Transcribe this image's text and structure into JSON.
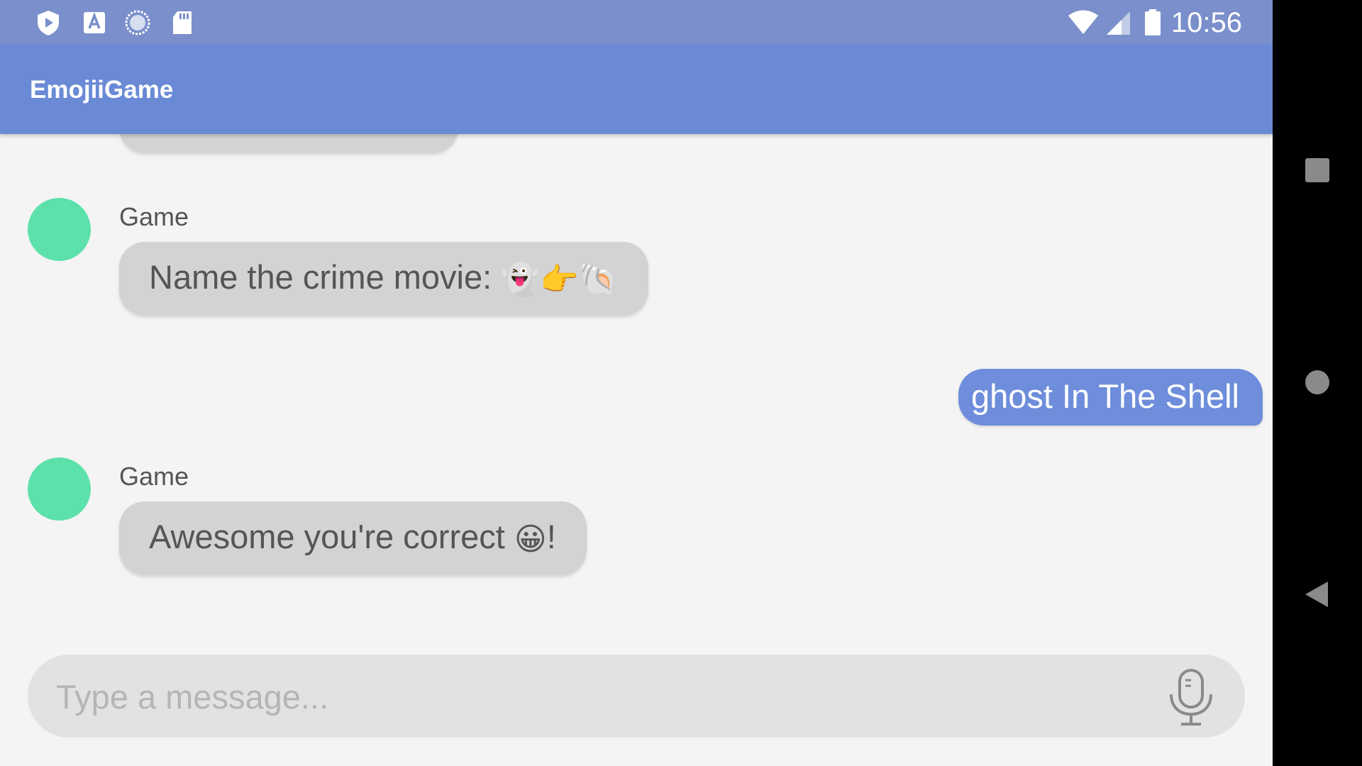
{
  "status_bar": {
    "time": "10:56",
    "icons": [
      "shield-play-icon",
      "a-notification-icon",
      "sync-icon",
      "sd-card-icon",
      "wifi-icon",
      "signal-icon",
      "battery-icon"
    ]
  },
  "app_bar": {
    "title": "EmojiiGame"
  },
  "messages": [
    {
      "sender": "Game",
      "text": "Name the crime movie: ",
      "emoji": "👻👉🐚"
    },
    {
      "user_text": "ghost In The Shell"
    },
    {
      "sender": "Game",
      "text": "Awesome you're correct ",
      "emoji": "😀",
      "suffix": "!"
    }
  ],
  "input": {
    "placeholder": "Type a message..."
  },
  "nav_bar": {
    "buttons": [
      "recents-icon",
      "home-icon",
      "back-icon"
    ]
  },
  "colors": {
    "status_bar": "#7a8fcb",
    "app_bar": "#6a8ad6",
    "avatar": "#5de1ab",
    "game_bubble": "#d3d3d3",
    "user_bubble": "#6e8ddb",
    "background": "#f4f4f4"
  }
}
